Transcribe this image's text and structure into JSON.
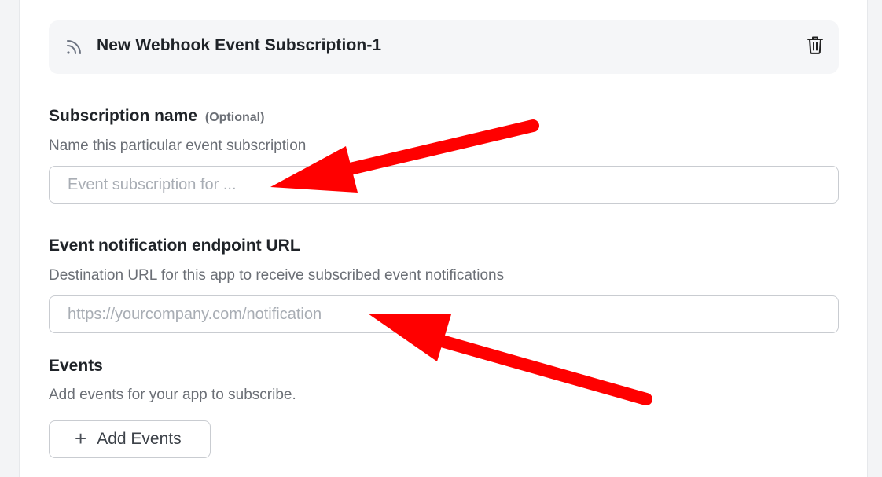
{
  "subscription": {
    "title": "New Webhook Event Subscription-1",
    "header_icon": "feed-icon",
    "delete_icon": "trash-icon"
  },
  "fields": {
    "name": {
      "label": "Subscription name",
      "optional": "(Optional)",
      "help": "Name this particular event subscription",
      "placeholder": "Event subscription for ...",
      "value": ""
    },
    "endpoint": {
      "label": "Event notification endpoint URL",
      "help": "Destination URL for this app to receive subscribed event notifications",
      "placeholder": "https://yourcompany.com/notification",
      "value": ""
    }
  },
  "events": {
    "label": "Events",
    "help": "Add events for your app to subscribe.",
    "add_button": "Add Events",
    "add_icon": "plus-icon"
  },
  "annotations": {
    "arrow_color": "#ff0000"
  }
}
